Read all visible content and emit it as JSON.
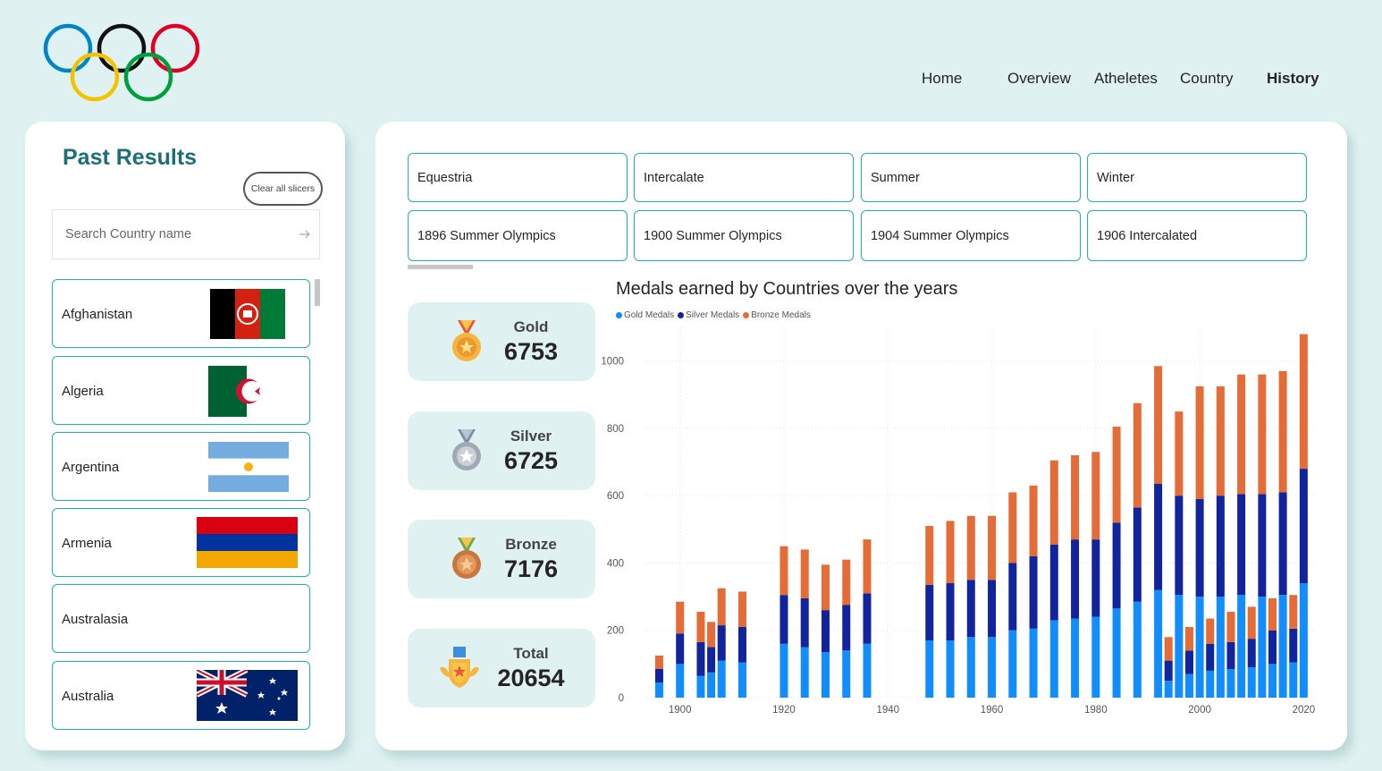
{
  "nav": {
    "items": [
      {
        "label": "Home",
        "active": false
      },
      {
        "label": "Overview",
        "active": false
      },
      {
        "label": "Atheletes",
        "active": false
      },
      {
        "label": "Country",
        "active": false
      },
      {
        "label": "History",
        "active": true
      }
    ]
  },
  "left_panel": {
    "title": "Past Results",
    "clear_label": "Clear all slicers",
    "search_placeholder": "Search Country name",
    "countries": [
      {
        "name": "Afghanistan",
        "flag": "afghanistan-flag"
      },
      {
        "name": "Algeria",
        "flag": "algeria-flag"
      },
      {
        "name": "Argentina",
        "flag": "argentina-flag"
      },
      {
        "name": "Armenia",
        "flag": "armenia-flag"
      },
      {
        "name": "Australasia",
        "flag": ""
      },
      {
        "name": "Australia",
        "flag": "australia-flag"
      }
    ]
  },
  "slicers": {
    "season_row": [
      "Equestria",
      "Intercalate",
      "Summer",
      "Winter"
    ],
    "games_row": [
      "1896 Summer Olympics",
      "1900 Summer Olympics",
      "1904 Summer Olympics",
      "1906 Intercalated"
    ]
  },
  "kpis": [
    {
      "label": "Gold",
      "value": "6753",
      "icon": "gold-medal-icon"
    },
    {
      "label": "Silver",
      "value": "6725",
      "icon": "silver-medal-icon"
    },
    {
      "label": "Bronze",
      "value": "7176",
      "icon": "bronze-medal-icon"
    },
    {
      "label": "Total",
      "value": "20654",
      "icon": "trophy-badge-icon"
    }
  ],
  "colors": {
    "gold": "#118dff",
    "silver": "#12239e",
    "bronze": "#e66c37",
    "accent": "#1fb5a8",
    "title": "#1b6f76"
  },
  "chart_data": {
    "type": "bar",
    "stacked": true,
    "title": "Medals earned by Countries over the years",
    "x_ticks": [
      "1900",
      "1920",
      "1940",
      "1960",
      "1980",
      "2000",
      "2020"
    ],
    "y_ticks": [
      "0",
      "200",
      "400",
      "600",
      "800",
      "1000"
    ],
    "ylim": [
      0,
      1100
    ],
    "xlim": [
      1893,
      2022
    ],
    "grid": true,
    "legend": "top-left",
    "x": [
      1896,
      1900,
      1904,
      1906,
      1908,
      1912,
      1920,
      1924,
      1928,
      1932,
      1936,
      1948,
      1952,
      1956,
      1960,
      1964,
      1968,
      1972,
      1976,
      1980,
      1984,
      1988,
      1992,
      1994,
      1996,
      1998,
      2000,
      2002,
      2004,
      2006,
      2008,
      2010,
      2012,
      2014,
      2016,
      2018,
      2020
    ],
    "series": [
      {
        "name": "Gold Medals",
        "values": [
          45,
          100,
          65,
          75,
          110,
          105,
          160,
          150,
          135,
          140,
          160,
          170,
          170,
          180,
          180,
          200,
          205,
          230,
          235,
          240,
          265,
          285,
          320,
          50,
          305,
          70,
          300,
          80,
          300,
          85,
          305,
          90,
          300,
          100,
          305,
          105,
          340
        ]
      },
      {
        "name": "Silver Medals",
        "values": [
          40,
          90,
          100,
          75,
          105,
          105,
          145,
          145,
          125,
          135,
          150,
          165,
          170,
          170,
          170,
          200,
          215,
          225,
          235,
          230,
          255,
          280,
          315,
          60,
          295,
          70,
          290,
          80,
          300,
          80,
          300,
          85,
          305,
          100,
          305,
          100,
          340
        ]
      },
      {
        "name": "Bronze Medals",
        "values": [
          40,
          95,
          90,
          75,
          110,
          105,
          145,
          145,
          135,
          135,
          160,
          175,
          185,
          190,
          190,
          210,
          210,
          250,
          250,
          260,
          285,
          310,
          350,
          70,
          250,
          70,
          335,
          75,
          325,
          90,
          355,
          95,
          355,
          95,
          360,
          100,
          400
        ]
      }
    ]
  }
}
